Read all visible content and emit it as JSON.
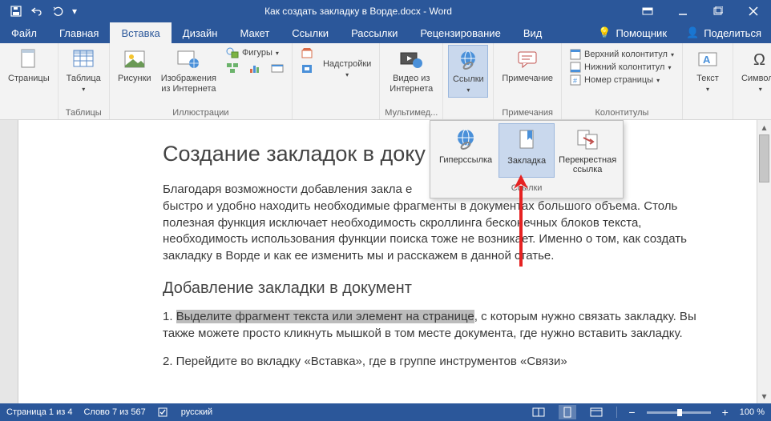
{
  "title": "Как создать закладку в Ворде.docx - Word",
  "tabs": {
    "file": "Файл",
    "home": "Главная",
    "insert": "Вставка",
    "design": "Дизайн",
    "layout": "Макет",
    "references": "Ссылки",
    "mailings": "Рассылки",
    "review": "Рецензирование",
    "view": "Вид"
  },
  "assist": "Помощник",
  "share": "Поделиться",
  "ribbon": {
    "pages": {
      "label": "Страницы",
      "btn": "Страницы"
    },
    "tables": {
      "label": "Таблицы",
      "btn": "Таблица"
    },
    "illustrations": {
      "label": "Иллюстрации",
      "pictures": "Рисунки",
      "online_pics": "Изображения из Интернета",
      "shapes": "Фигуры"
    },
    "addins": {
      "label": "",
      "btn": "Надстройки"
    },
    "media": {
      "label": "Мультимед...",
      "btn": "Видео из Интернета"
    },
    "links": {
      "label": "",
      "btn": "Ссылки"
    },
    "comments": {
      "label": "Примечания",
      "btn": "Примечание"
    },
    "headerfooter": {
      "label": "Колонтитулы",
      "header": "Верхний колонтитул",
      "footer": "Нижний колонтитул",
      "pagenum": "Номер страницы"
    },
    "text": {
      "label": "",
      "btn": "Текст"
    },
    "symbols": {
      "label": "",
      "btn": "Символы"
    }
  },
  "dropdown": {
    "label": "Ссылки",
    "hyperlink": "Гиперссылка",
    "bookmark": "Закладка",
    "crossref": "Перекрестная ссылка"
  },
  "doc": {
    "h1": "Создание закладок в доку",
    "p1": "Благодаря возможности добавления закла                                                            е\nбыстро и удобно находить необходимые фрагменты в документах большого объема. Столь полезная функция исключает необходимость скроллинга бесконечных блоков текста, необходимость использования функции поиска тоже не возникает. Именно о том, как создать закладку в Ворде и как ее изменить мы и расскажем в данной статье.",
    "h2": "Добавление закладки в документ",
    "p2_pre": "1. ",
    "p2_hi": "Выделите фрагмент текста или элемент на странице",
    "p2_post": ", с которым нужно связать закладку. Вы также можете просто кликнуть мышкой в том месте документа, где нужно вставить закладку.",
    "p3": "2. Перейдите во вкладку «Вставка», где в группе инструментов «Связи»"
  },
  "status": {
    "page": "Страница 1 из 4",
    "words": "Слово 7 из 567",
    "lang": "русский",
    "zoom": "100 %"
  }
}
